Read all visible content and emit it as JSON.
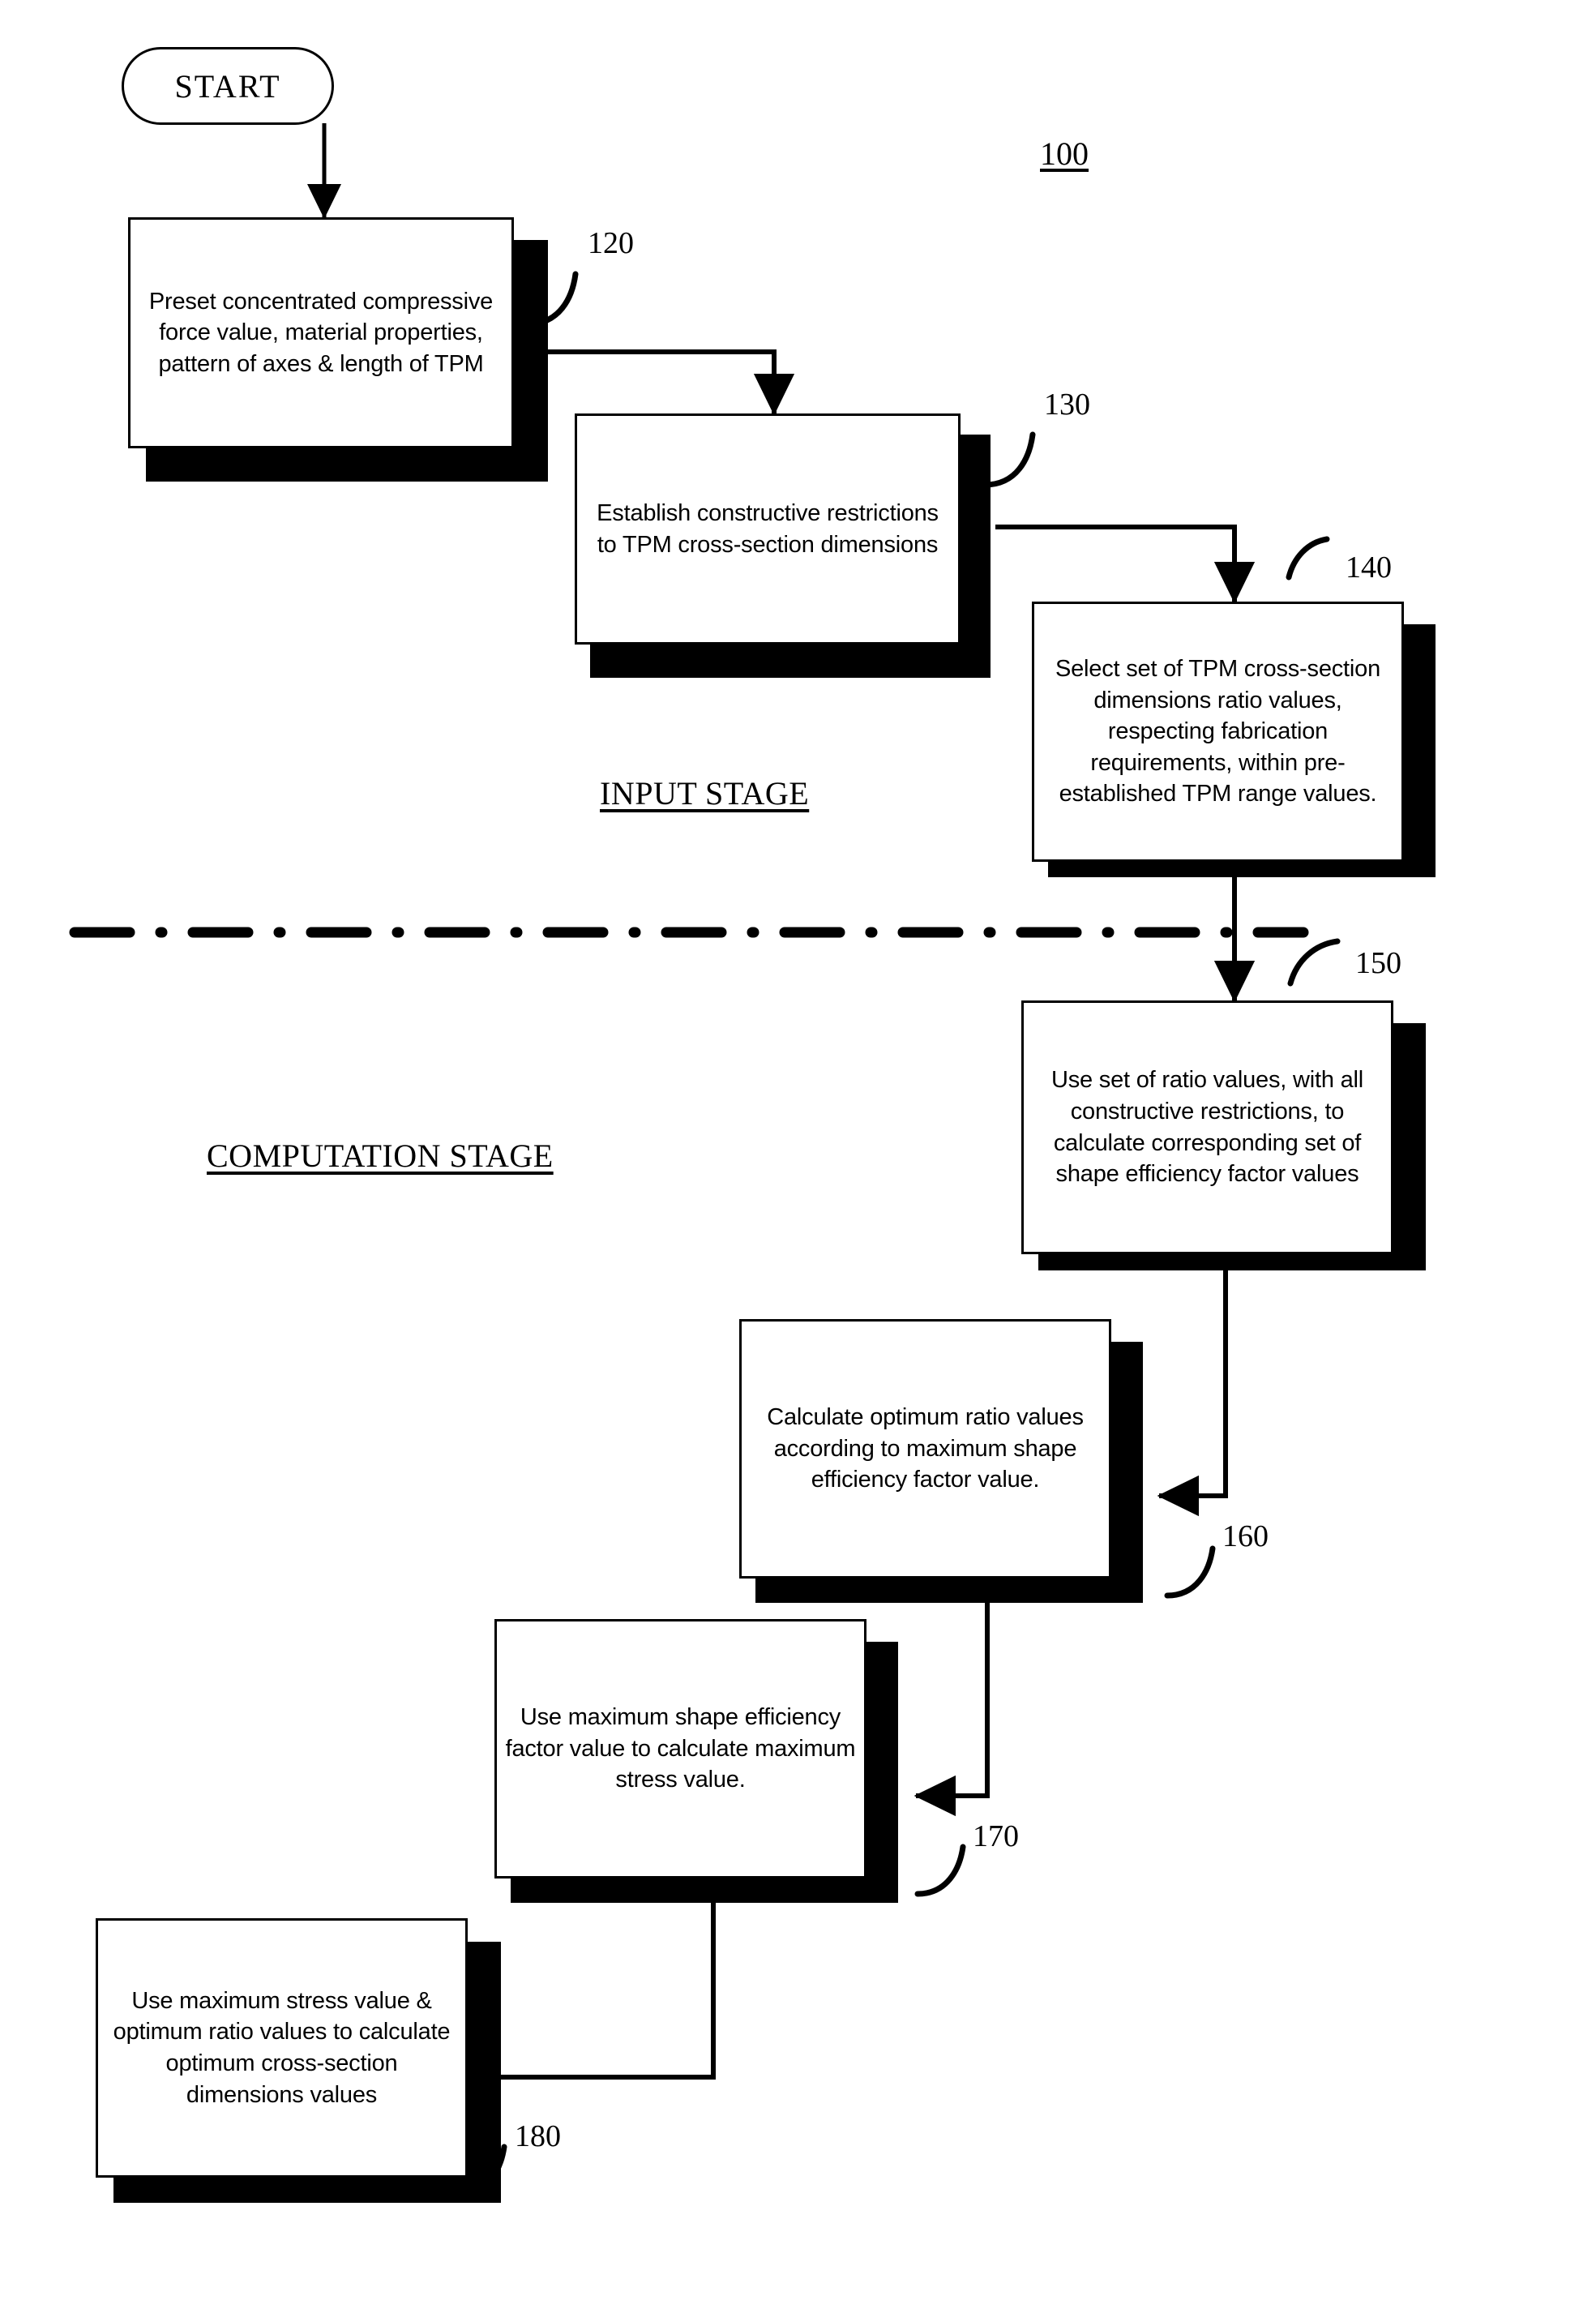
{
  "figure": {
    "number": "100",
    "start_label": "START"
  },
  "stages": [
    {
      "id": "input-stage",
      "label": "INPUT STAGE"
    },
    {
      "id": "computation-stage",
      "label": "COMPUTATION STAGE"
    }
  ],
  "nodes": [
    {
      "ref": "120",
      "text": "Preset concentrated compressive force value, material properties, pattern of axes & length of TPM"
    },
    {
      "ref": "130",
      "text": "Establish constructive restrictions to TPM cross-section dimensions"
    },
    {
      "ref": "140",
      "text": "Select set of TPM cross-section dimensions ratio values, respecting fabrication requirements, within pre-established TPM range values."
    },
    {
      "ref": "150",
      "text": "Use set of ratio values, with all constructive restrictions, to calculate corresponding set of shape efficiency factor values"
    },
    {
      "ref": "160",
      "text": "Calculate optimum ratio values according to maximum shape efficiency factor value."
    },
    {
      "ref": "170",
      "text": "Use maximum shape efficiency factor value to calculate maximum stress value."
    },
    {
      "ref": "180",
      "text": "Use maximum stress value & optimum ratio values to calculate optimum cross-section dimensions values"
    }
  ],
  "colors": {
    "ink": "#000000",
    "paper": "#ffffff"
  }
}
